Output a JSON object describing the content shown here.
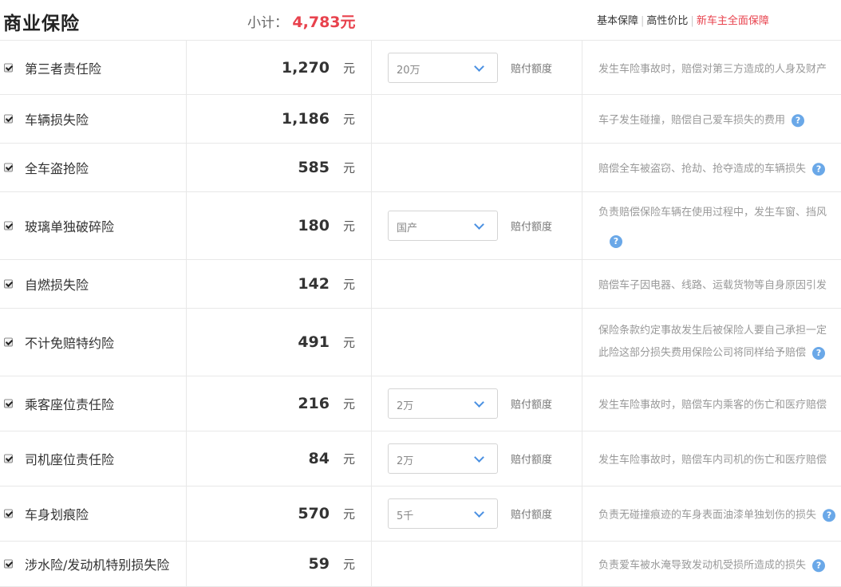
{
  "header": {
    "title": "商业保险",
    "subtotal_label": "小计：",
    "subtotal_amount": "4,783元",
    "tabs": [
      {
        "label": "基本保障",
        "active": false
      },
      {
        "label": "高性价比",
        "active": false
      },
      {
        "label": "新车主全面保障",
        "active": true
      }
    ]
  },
  "unit": "元",
  "option_label": "赔付额度",
  "colors": {
    "accent": "#e8424d",
    "help": "#6aa8e8",
    "chevron": "#4a90e2"
  },
  "rows": [
    {
      "name": "第三者责任险",
      "price": "1,270",
      "select": "20万",
      "desc": [
        "发生车险事故时，赔偿对第三方造成的人身及财产"
      ],
      "help": false
    },
    {
      "name": "车辆损失险",
      "price": "1,186",
      "select": null,
      "desc": [
        "车子发生碰撞，赔偿自己爱车损失的费用"
      ],
      "help": true
    },
    {
      "name": "全车盗抢险",
      "price": "585",
      "select": null,
      "desc": [
        "赔偿全车被盗窃、抢劫、抢夺造成的车辆损失"
      ],
      "help": true
    },
    {
      "name": "玻璃单独破碎险",
      "price": "180",
      "select": "国产",
      "desc": [
        "负责赔偿保险车辆在使用过程中，发生车窗、挡风"
      ],
      "help": true,
      "help_block": true
    },
    {
      "name": "自燃损失险",
      "price": "142",
      "select": null,
      "desc": [
        "赔偿车子因电器、线路、运载货物等自身原因引发"
      ],
      "help": false
    },
    {
      "name": "不计免赔特约险",
      "price": "491",
      "select": null,
      "desc": [
        "保险条款约定事故发生后被保险人要自己承担一定",
        "此险这部分损失费用保险公司将同样给予赔偿"
      ],
      "help": true
    },
    {
      "name": "乘客座位责任险",
      "price": "216",
      "select": "2万",
      "desc": [
        "发生车险事故时，赔偿车内乘客的伤亡和医疗赔偿"
      ],
      "help": false
    },
    {
      "name": "司机座位责任险",
      "price": "84",
      "select": "2万",
      "desc": [
        "发生车险事故时，赔偿车内司机的伤亡和医疗赔偿"
      ],
      "help": false
    },
    {
      "name": "车身划痕险",
      "price": "570",
      "select": "5千",
      "desc": [
        "负责无碰撞痕迹的车身表面油漆单独划伤的损失"
      ],
      "help": true
    },
    {
      "name": "涉水险/发动机特别损失险",
      "price": "59",
      "select": null,
      "desc": [
        "负责爱车被水淹导致发动机受损所造成的损失"
      ],
      "help": true
    }
  ]
}
